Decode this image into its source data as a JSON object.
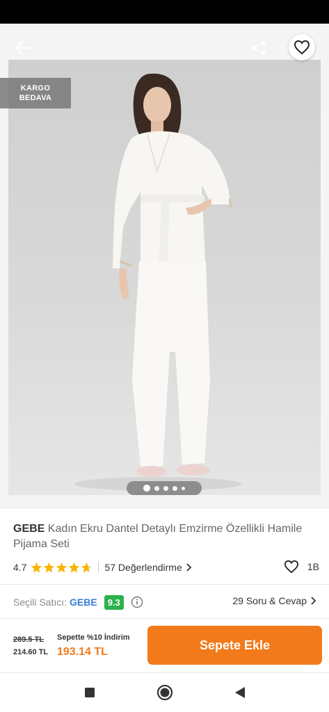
{
  "header": {
    "back_icon": "arrow-left-icon",
    "share_icon": "share-icon",
    "favorite_icon": "heart-outline-icon"
  },
  "badge": {
    "line1": "KARGO",
    "line2": "BEDAVA"
  },
  "gallery": {
    "image_count": 5,
    "active_index": 0
  },
  "product": {
    "brand": "GEBE",
    "name": " Kadın Ekru Dantel Detaylı Emzirme Özellikli Hamile Pijama Seti"
  },
  "rating": {
    "value": "4.7",
    "stars": 4.7,
    "reviews_label": "57 Değerlendirme",
    "favorites_count": "1B"
  },
  "seller": {
    "label": "Seçili Satıcı:",
    "name": "GEBE",
    "score": "9.3",
    "qa_label": "29 Soru & Cevap"
  },
  "pricing": {
    "old_price": "289.5 TL",
    "price": "214.60 TL",
    "discount_label": "Sepette %10 İndirim",
    "final_price": "193.14 TL",
    "add_to_cart_label": "Sepete Ekle"
  },
  "colors": {
    "accent": "#f27a1a",
    "star": "#f8b600",
    "score_badge": "#2bb24c",
    "seller_link": "#3a7bd5"
  }
}
